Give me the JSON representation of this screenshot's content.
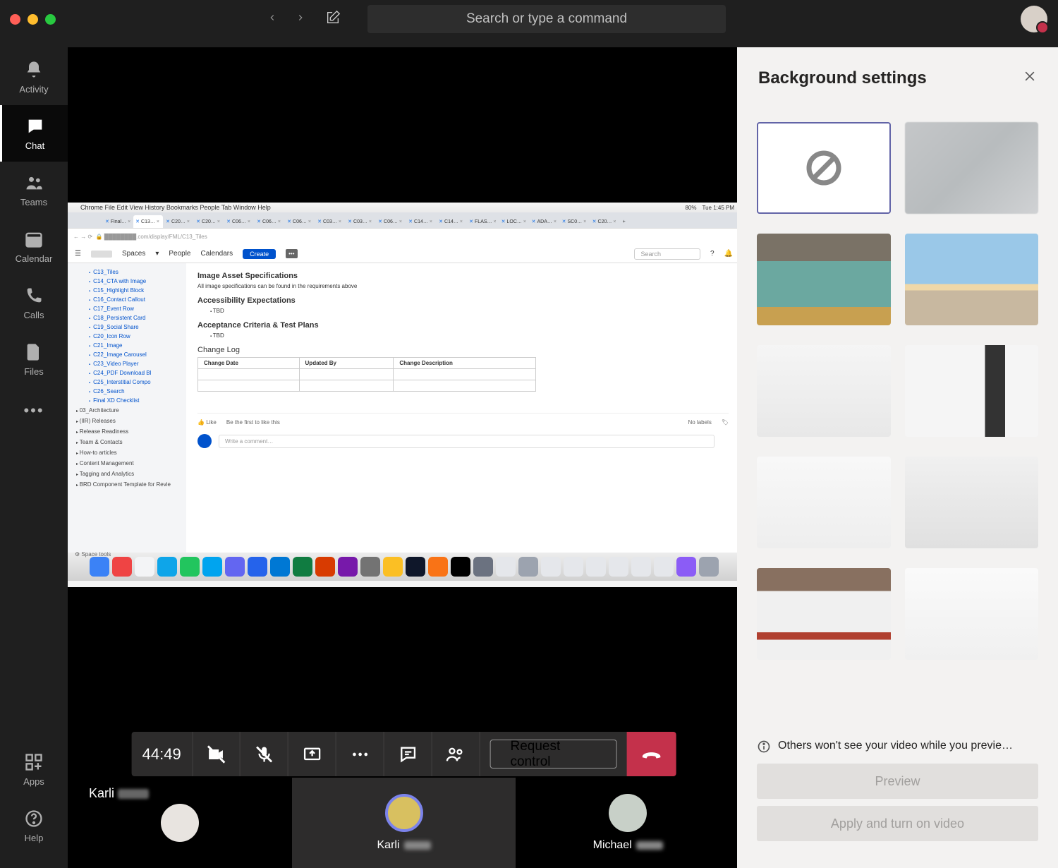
{
  "titlebar": {
    "search_placeholder": "Search or type a command"
  },
  "rail": {
    "activity": "Activity",
    "chat": "Chat",
    "teams": "Teams",
    "calendar": "Calendar",
    "calls": "Calls",
    "files": "Files",
    "apps": "Apps",
    "help": "Help"
  },
  "call": {
    "timer": "44:49",
    "request_control": "Request control",
    "presenter_first": "Karli"
  },
  "participants": [
    {
      "name": ""
    },
    {
      "name": "Karli"
    },
    {
      "name": "Michael"
    }
  ],
  "bg_panel": {
    "title": "Background settings",
    "info": "Others won't see your video while you previe…",
    "preview": "Preview",
    "apply": "Apply and turn on video"
  },
  "shared": {
    "menubar_items": [
      "Chrome",
      "File",
      "Edit",
      "View",
      "History",
      "Bookmarks",
      "People",
      "Tab",
      "Window",
      "Help"
    ],
    "battery": "80%",
    "clock": "Tue 1:45 PM",
    "tabs": [
      "Final…",
      "C13…",
      "C20…",
      "C20…",
      "C06…",
      "C06…",
      "C06…",
      "C03…",
      "C03…",
      "C06…",
      "C14…",
      "C14…",
      "FLAS…",
      "LOC…",
      "ADA…",
      "SC0…",
      "C20…"
    ],
    "url_suffix": ".com/display/FML/C13_Tiles",
    "spaces": "Spaces",
    "people": "People",
    "calendars": "Calendars",
    "create": "Create",
    "search": "Search",
    "sidebar_items": [
      "C13_Tiles",
      "C14_CTA with Image",
      "C15_Highlight Block",
      "C16_Contact Callout",
      "C17_Event Row",
      "C18_Persistent Card",
      "C19_Social Share",
      "C20_Icon Row",
      "C21_Image",
      "C22_Image Carousel",
      "C23_Video Player",
      "C24_PDF Download Bl",
      "C25_Interstitial Compo",
      "C26_Search",
      "Final XD Checklist"
    ],
    "sidebar_groups": [
      "03_Architecture",
      "(IIR) Releases",
      "Release Readiness",
      "Team & Contacts",
      "How-to articles",
      "Content Management",
      "Tagging and Analytics",
      "BRD Component Template for Revie"
    ],
    "space_tools": "Space tools",
    "section1": "Image Asset Specifications",
    "section1_text": "All image specifications can be found in the requirements above",
    "section2": "Accessibility Expectations",
    "tbd": "TBD",
    "section3": "Acceptance Criteria & Test Plans",
    "section4": "Change Log",
    "th1": "Change Date",
    "th2": "Updated By",
    "th3": "Change Description",
    "like": "Like",
    "be_first": "Be the first to like this",
    "no_labels": "No labels",
    "comment_placeholder": "Write a comment…"
  }
}
